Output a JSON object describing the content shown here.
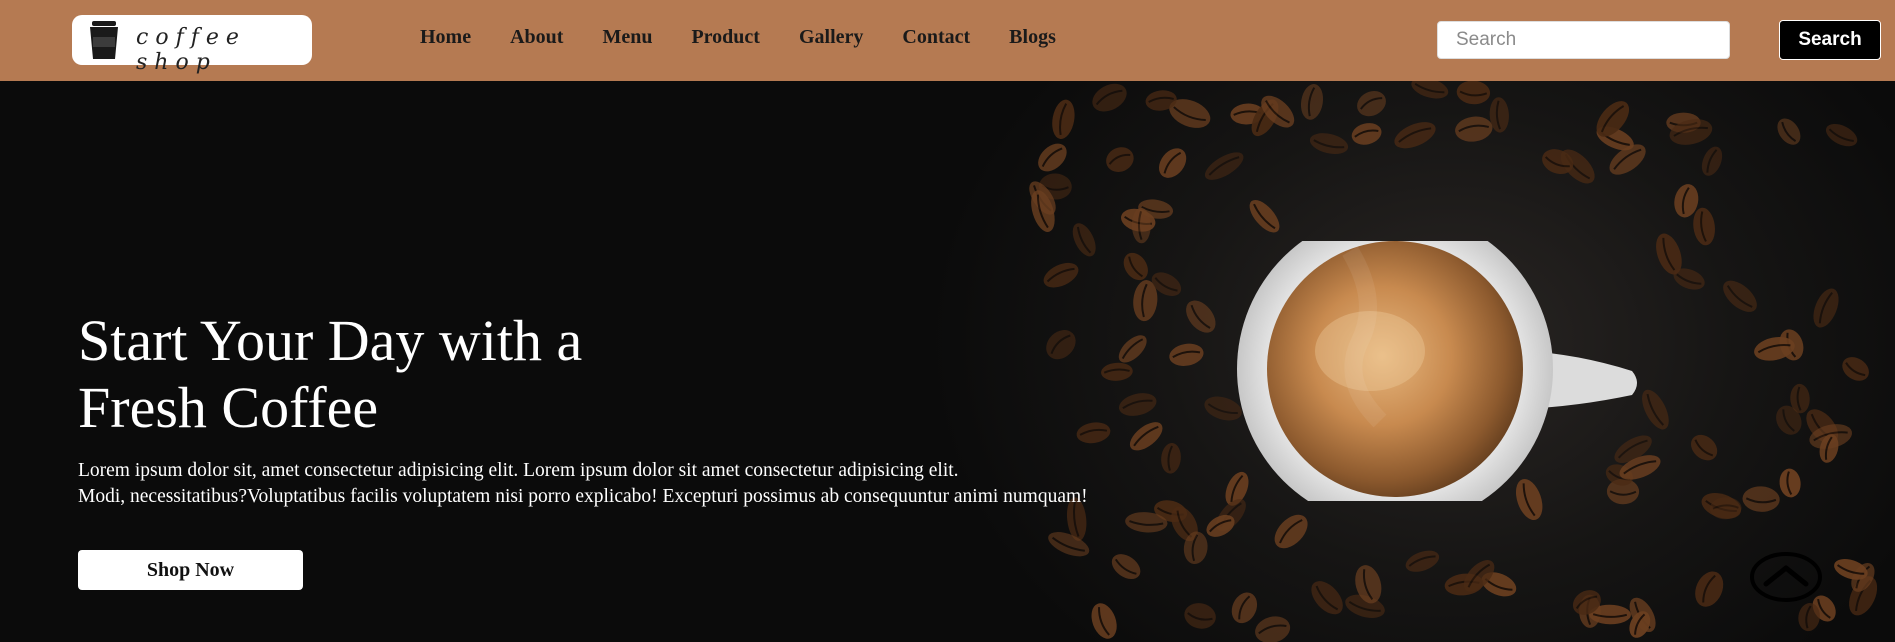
{
  "logo": {
    "text": "coffee shop",
    "icon": "coffee-cup-icon"
  },
  "nav": {
    "items": [
      "Home",
      "About",
      "Menu",
      "Product",
      "Gallery",
      "Contact",
      "Blogs"
    ]
  },
  "search": {
    "placeholder": "Search",
    "value": "",
    "button_label": "Search"
  },
  "hero": {
    "title_line1": "Start Your Day with a",
    "title_line2": "Fresh Coffee",
    "text_line1": "Lorem ipsum dolor sit, amet consectetur adipisicing elit. Lorem ipsum dolor sit amet consectetur adipisicing elit.",
    "text_line2": "Modi, necessitatibus?Voluptatibus facilis voluptatem nisi porro explicabo! Excepturi possimus ab consequuntur animi numquam!",
    "cta_label": "Shop Now"
  },
  "scroll_top": {
    "icon": "chevron-up-icon"
  },
  "colors": {
    "header_bg": "#b57a52",
    "hero_bg": "#0b0b0b",
    "button_dark": "#000000",
    "button_light": "#ffffff"
  }
}
